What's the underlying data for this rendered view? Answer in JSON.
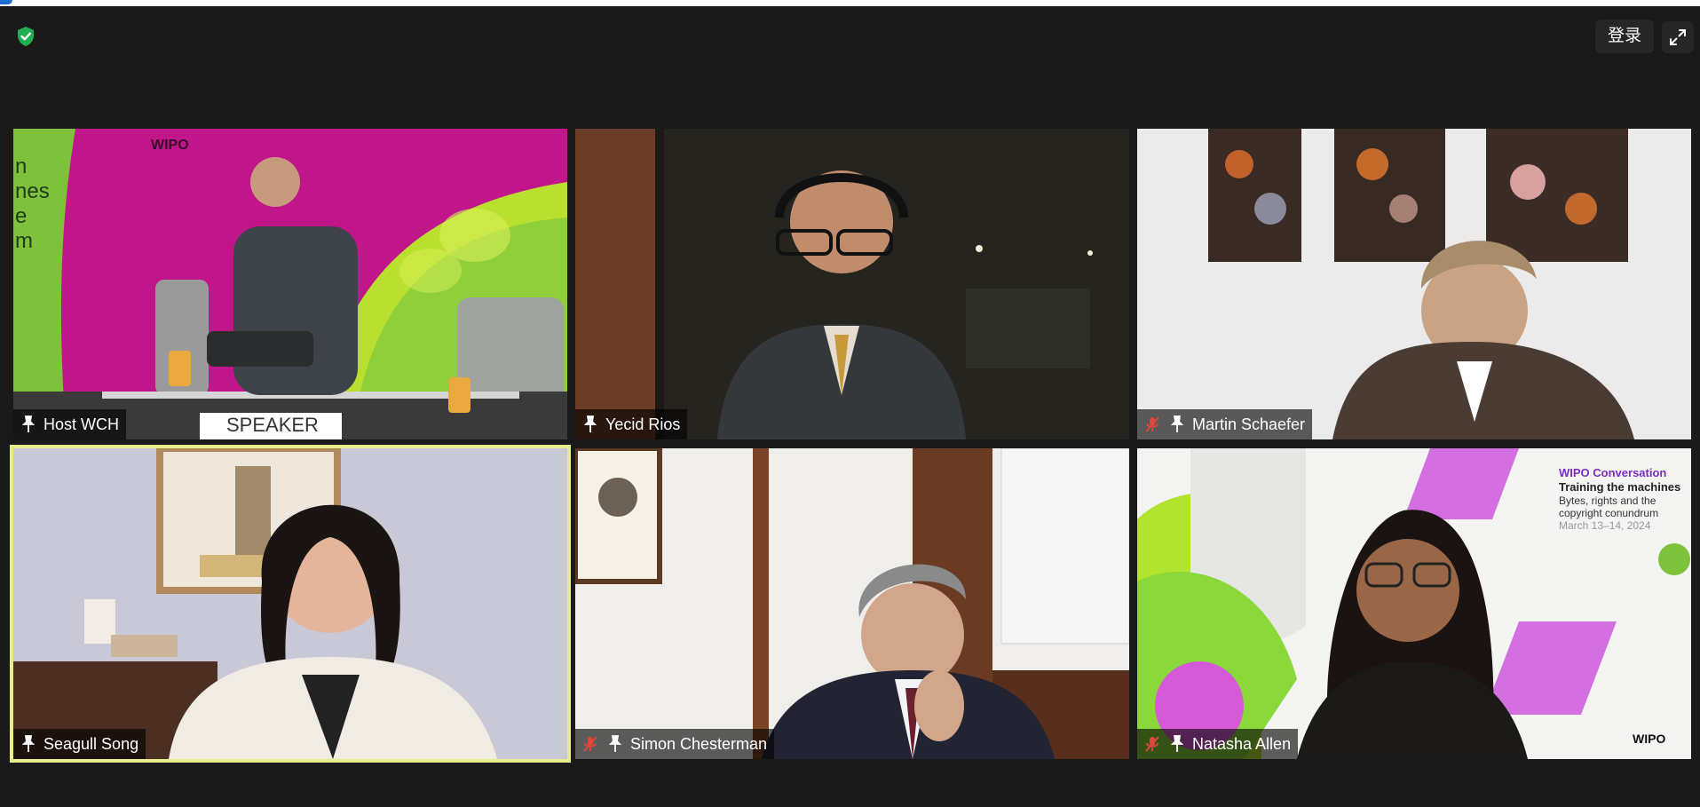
{
  "header": {
    "shield_icon": "shield-check-icon",
    "login_label": "登录",
    "fullscreen_icon": "expand-icon"
  },
  "participants": [
    {
      "name": "Host WCH",
      "muted": false,
      "pinned": true,
      "speaking": false
    },
    {
      "name": "Yecid Rios",
      "muted": false,
      "pinned": true,
      "speaking": false
    },
    {
      "name": "Martin Schaefer",
      "muted": true,
      "pinned": true,
      "speaking": false
    },
    {
      "name": "Seagull Song",
      "muted": false,
      "pinned": true,
      "speaking": true
    },
    {
      "name": "Simon Chesterman",
      "muted": true,
      "pinned": true,
      "speaking": false
    },
    {
      "name": "Natasha Allen",
      "muted": true,
      "pinned": true,
      "speaking": false
    }
  ],
  "scene_text": {
    "wipo_logo": "WIPO",
    "speaker_sign": "SPEAKER",
    "side_text": [
      "n",
      "nes",
      "e",
      "m"
    ],
    "conversation_title": "WIPO Conversation",
    "conversation_subtitle": "Training the machines",
    "conversation_lines": [
      "Bytes, rights and the",
      "copyright conundrum"
    ],
    "conversation_date": "March 13–14, 2024",
    "wipo_footer": "WIPO"
  },
  "colors": {
    "background": "#1a1a1a",
    "active_border": "#e9ec8a",
    "shield_green": "#1fb054",
    "muted_red": "#e0463d"
  }
}
